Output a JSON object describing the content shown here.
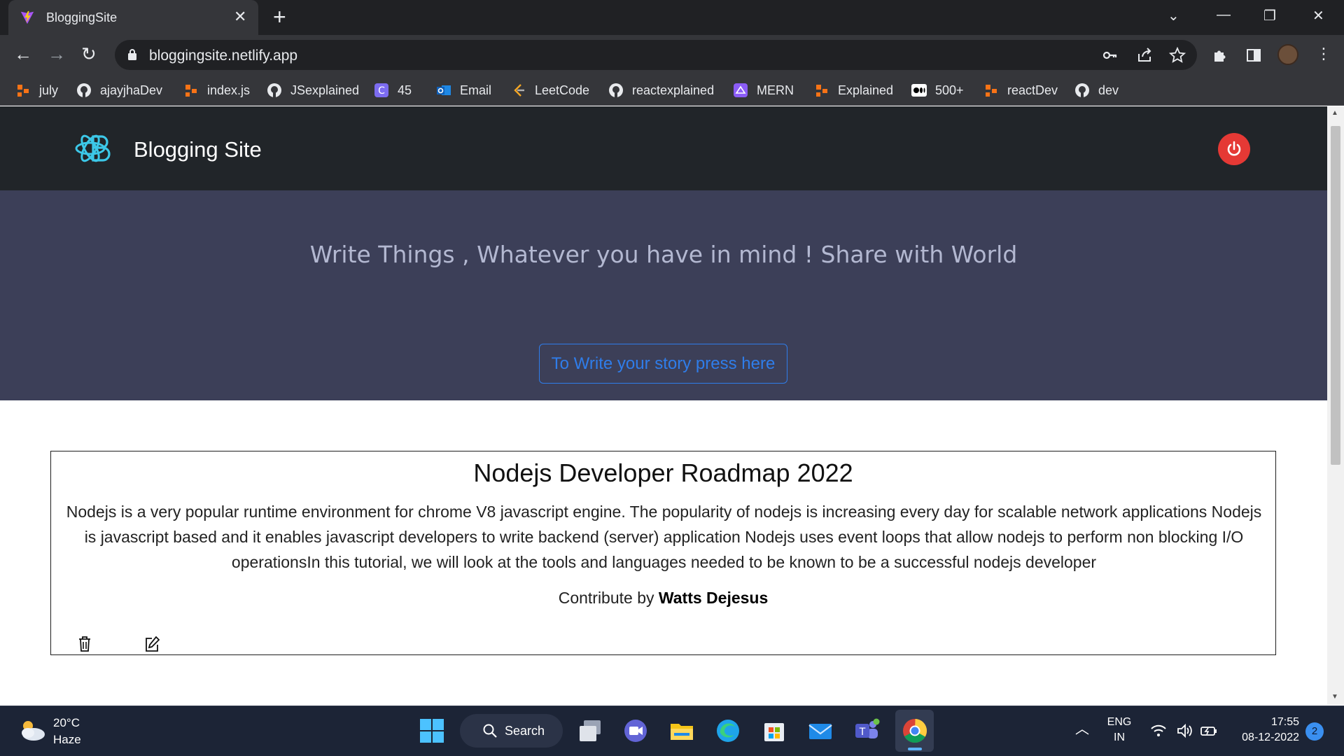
{
  "browser": {
    "tab_title": "BloggingSite",
    "tab_close": "✕",
    "new_tab": "+",
    "window_controls": [
      "⌄",
      "—",
      "❐",
      "✕"
    ],
    "url": "bloggingsite.netlify.app",
    "bookmarks": [
      {
        "label": "july",
        "icon": "orange-blocks-icon"
      },
      {
        "label": "ajayjhaDev",
        "icon": "github-icon"
      },
      {
        "label": "index.js",
        "icon": "orange-blocks-icon"
      },
      {
        "label": "JSexplained",
        "icon": "github-icon"
      },
      {
        "label": "45",
        "icon": "c-square-icon"
      },
      {
        "label": "Email",
        "icon": "outlook-icon"
      },
      {
        "label": "LeetCode",
        "icon": "leetcode-icon"
      },
      {
        "label": "reactexplained",
        "icon": "github-icon"
      },
      {
        "label": "MERN",
        "icon": "purple-square-icon"
      },
      {
        "label": "Explained",
        "icon": "orange-blocks-icon"
      },
      {
        "label": "500+",
        "icon": "medium-icon"
      },
      {
        "label": "reactDev",
        "icon": "orange-blocks-icon"
      },
      {
        "label": "dev",
        "icon": "github-icon"
      }
    ]
  },
  "site": {
    "brand": "Blogging Site",
    "tagline": "Write Things , Whatever you have in mind ! Share with World",
    "write_button": "To Write your story press here",
    "posts": [
      {
        "title": "Nodejs Developer Roadmap 2022",
        "body": "Nodejs is a very popular runtime environment for chrome V8 javascript engine. The popularity of nodejs is increasing every day for scalable network applications Nodejs is javascript based and it enables javascript developers to write backend (server) application Nodejs uses event loops that allow nodejs to perform non blocking I/O operationsIn this tutorial, we will look at the tools and languages needed to be known to be a successful nodejs developer",
        "author_prefix": "Contribute by",
        "author": "Watts Dejesus"
      }
    ]
  },
  "taskbar": {
    "weather_temp": "20°C",
    "weather_desc": "Haze",
    "search_label": "Search",
    "lang": "ENG",
    "region": "IN",
    "time": "17:55",
    "date": "08-12-2022",
    "notifications": "2"
  },
  "colors": {
    "nav_bg": "#212529",
    "hero_bg": "#3c3f58",
    "accent_blue": "#2f7dea",
    "power_red": "#e53935",
    "logo_cyan": "#3cc8e8"
  }
}
